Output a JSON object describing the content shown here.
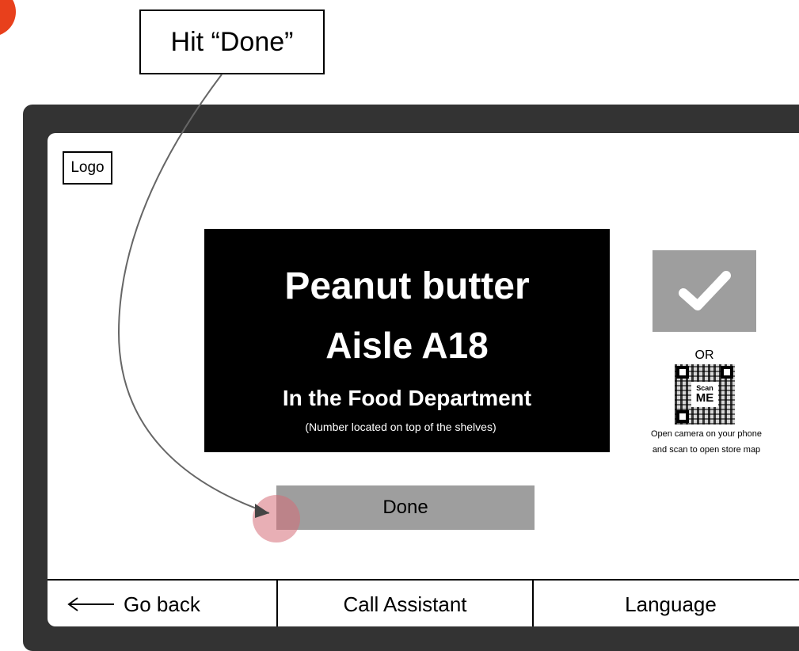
{
  "annotation": {
    "callout_text": "Hit “Done”",
    "badge_color": "#e8401c",
    "tap_indicator_color": "#d66e78"
  },
  "kiosk": {
    "logo_text": "Logo",
    "product": {
      "name": "Peanut butter",
      "aisle": "Aisle A18",
      "department": "In the Food Department",
      "note": "(Number located on top of the shelves)"
    },
    "confirm_icon": "checkmark-icon",
    "or_text": "OR",
    "qr": {
      "label_top": "Scan",
      "label_bottom": "ME",
      "instructions_line1": "Open camera on your phone",
      "instructions_line2": "and scan to open store map"
    },
    "done_label": "Done",
    "bottom_bar": {
      "back_label": "Go back",
      "back_icon": "left-arrow-icon",
      "assistant_label": "Call Assistant",
      "language_label": "Language"
    },
    "colors": {
      "device_frame": "#333333",
      "product_panel": "#000000",
      "button_gray": "#9e9e9e"
    }
  }
}
